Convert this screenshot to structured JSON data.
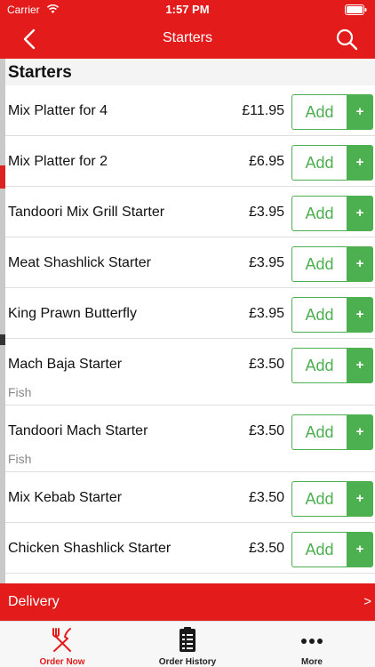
{
  "status_bar": {
    "carrier": "Carrier",
    "time": "1:57 PM"
  },
  "nav": {
    "title": "Starters"
  },
  "section": {
    "title": "Starters"
  },
  "add_button": {
    "label": "Add",
    "plus": "+"
  },
  "items": [
    {
      "name": "Mix Platter for 4",
      "price": "£11.95",
      "sub": ""
    },
    {
      "name": "Mix Platter for 2",
      "price": "£6.95",
      "sub": ""
    },
    {
      "name": "Tandoori Mix Grill Starter",
      "price": "£3.95",
      "sub": ""
    },
    {
      "name": "Meat Shashlick Starter",
      "price": "£3.95",
      "sub": ""
    },
    {
      "name": "King Prawn Butterfly",
      "price": "£3.95",
      "sub": ""
    },
    {
      "name": "Mach Baja Starter",
      "price": "£3.50",
      "sub": "Fish"
    },
    {
      "name": "Tandoori Mach Starter",
      "price": "£3.50",
      "sub": "Fish"
    },
    {
      "name": "Mix Kebab Starter",
      "price": "£3.50",
      "sub": ""
    },
    {
      "name": "Chicken Shashlick Starter",
      "price": "£3.50",
      "sub": ""
    }
  ],
  "delivery": {
    "label": "Delivery",
    "arrow": ">"
  },
  "tabs": [
    {
      "label": "Order Now",
      "icon": "fork-knife-icon"
    },
    {
      "label": "Order History",
      "icon": "clipboard-icon"
    },
    {
      "label": "More",
      "icon": "more-dots-icon"
    }
  ],
  "colors": {
    "brand_red": "#e31b1b",
    "add_green": "#4caf50"
  }
}
